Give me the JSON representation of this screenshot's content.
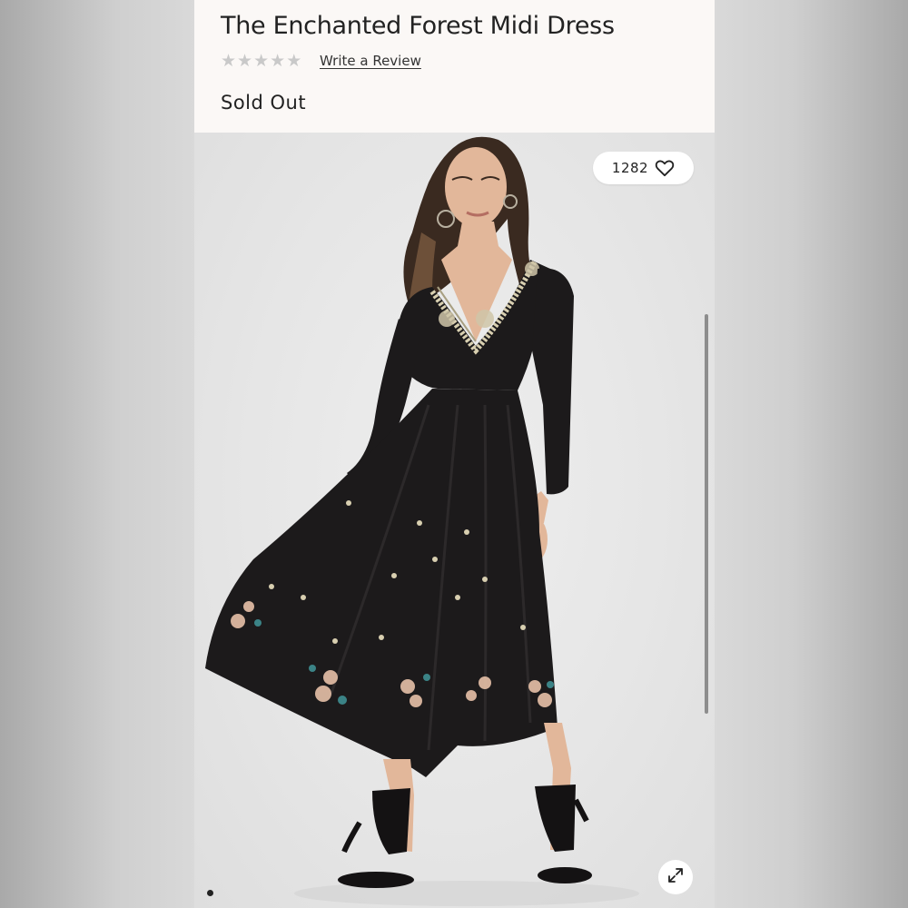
{
  "product": {
    "title": "The Enchanted Forest Midi Dress",
    "rating_stars": 5,
    "rating_filled": 0,
    "review_link": "Write a Review",
    "status": "Sold Out"
  },
  "gallery": {
    "like_count": "1282",
    "like_icon": "heart-outline-icon",
    "expand_icon": "expand-arrows-icon",
    "current_image_index": 1
  },
  "colors": {
    "header_bg": "#fbf8f6",
    "text": "#222222",
    "star_empty": "#c9c9c9",
    "dress": "#1c1a1b"
  }
}
